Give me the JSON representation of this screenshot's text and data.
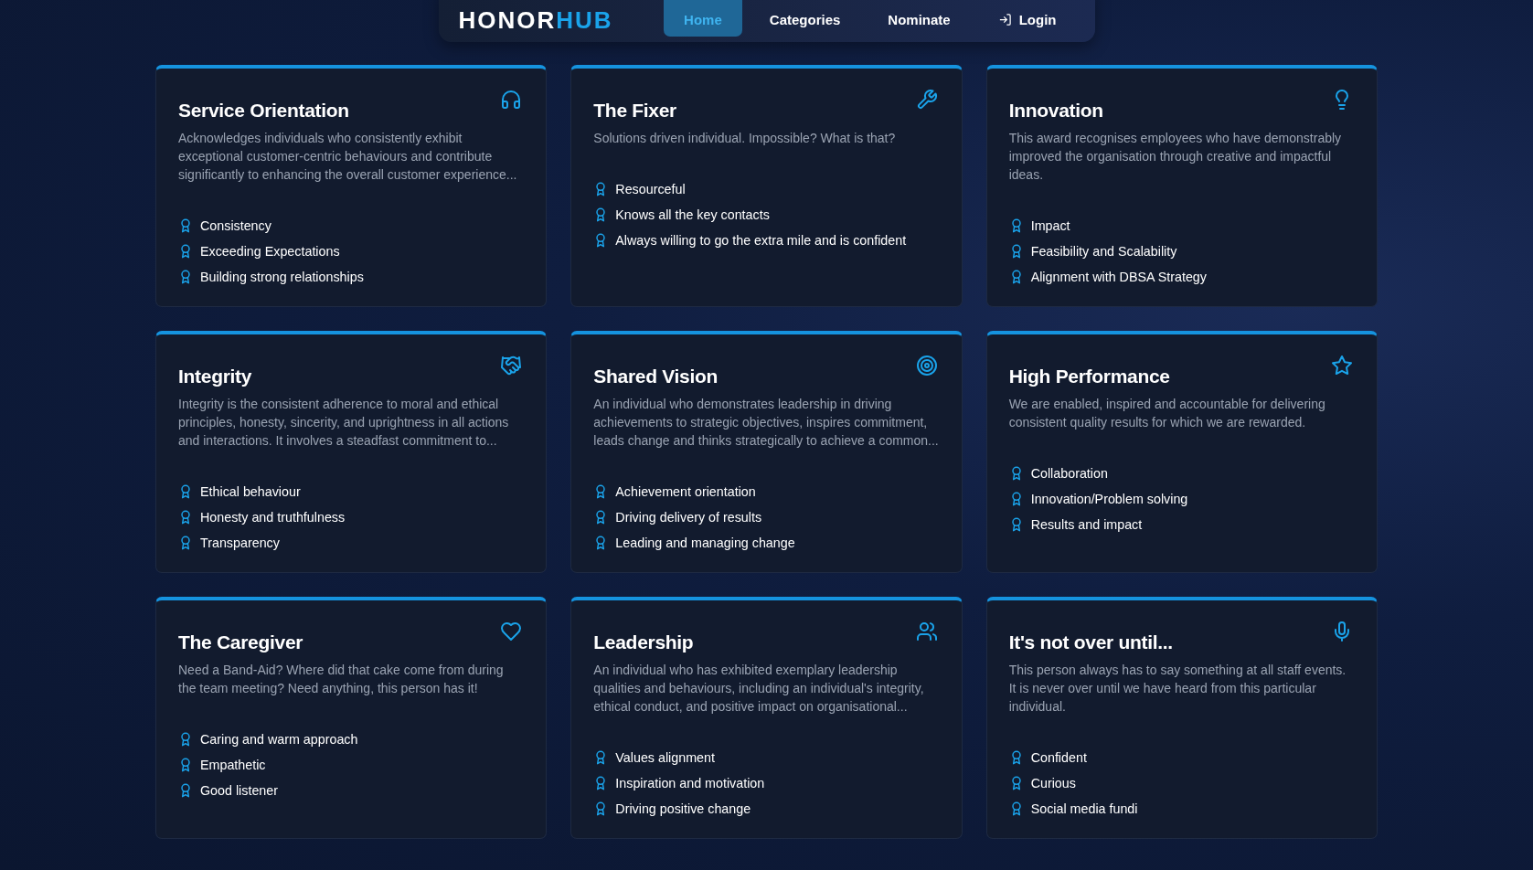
{
  "nav": {
    "logo": {
      "first": "HONOR",
      "second": "HUB"
    },
    "links": [
      {
        "label": "Home",
        "selected": true
      },
      {
        "label": "Categories",
        "selected": false
      },
      {
        "label": "Nominate",
        "selected": false
      },
      {
        "label": "Login",
        "selected": false,
        "kind": "login"
      }
    ]
  },
  "cards": [
    {
      "title": "Service Orientation",
      "description": "Acknowledges individuals who consistently exhibit exceptional customer-centric behaviours and contribute significantly to enhancing the overall customer experience...",
      "criteria": [
        "Consistency",
        "Exceeding Expectations",
        "Building strong relationships"
      ]
    },
    {
      "title": "The Fixer",
      "description": "Solutions driven individual. Impossible? What is that?",
      "criteria": [
        "Resourceful",
        "Knows all the key contacts",
        "Always willing to go the extra mile and is confident"
      ]
    },
    {
      "title": "Innovation",
      "description": "This award recognises employees who have demonstrably improved the organisation through creative and impactful ideas.",
      "criteria": [
        "Impact",
        "Feasibility and Scalability",
        "Alignment with DBSA Strategy"
      ]
    },
    {
      "title": "Integrity",
      "description": "Integrity is the consistent adherence to moral and ethical principles, honesty, sincerity, and uprightness in all actions and interactions. It involves a steadfast commitment to...",
      "criteria": [
        "Ethical behaviour",
        "Honesty and truthfulness",
        "Transparency"
      ]
    },
    {
      "title": "Shared Vision",
      "description": "An individual who demonstrates leadership in driving achievements to strategic objectives, inspires commitment, leads change and thinks strategically to achieve a common...",
      "criteria": [
        "Achievement orientation",
        "Driving delivery of results",
        "Leading and managing change"
      ]
    },
    {
      "title": "High Performance",
      "description": "We are enabled, inspired and accountable for delivering consistent quality results for which we are rewarded.",
      "criteria": [
        "Collaboration",
        "Innovation/Problem solving",
        "Results and impact"
      ]
    },
    {
      "title": "The Caregiver",
      "description": "Need a Band-Aid? Where did that cake come from during the team meeting? Need anything, this person has it!",
      "criteria": [
        "Caring and warm approach",
        "Empathetic",
        "Good listener"
      ]
    },
    {
      "title": "Leadership",
      "description": "An individual who has exhibited exemplary leadership qualities and behaviours, including an individual's integrity, ethical conduct, and positive impact on organisational...",
      "criteria": [
        "Values alignment",
        "Inspiration and motivation",
        "Driving positive change"
      ]
    },
    {
      "title": "It's not over until...",
      "description": "This person always has to say something at all staff events. It is never over until we have heard from this particular individual.",
      "criteria": [
        "Confident",
        "Curious",
        "Social media fundi"
      ]
    }
  ]
}
